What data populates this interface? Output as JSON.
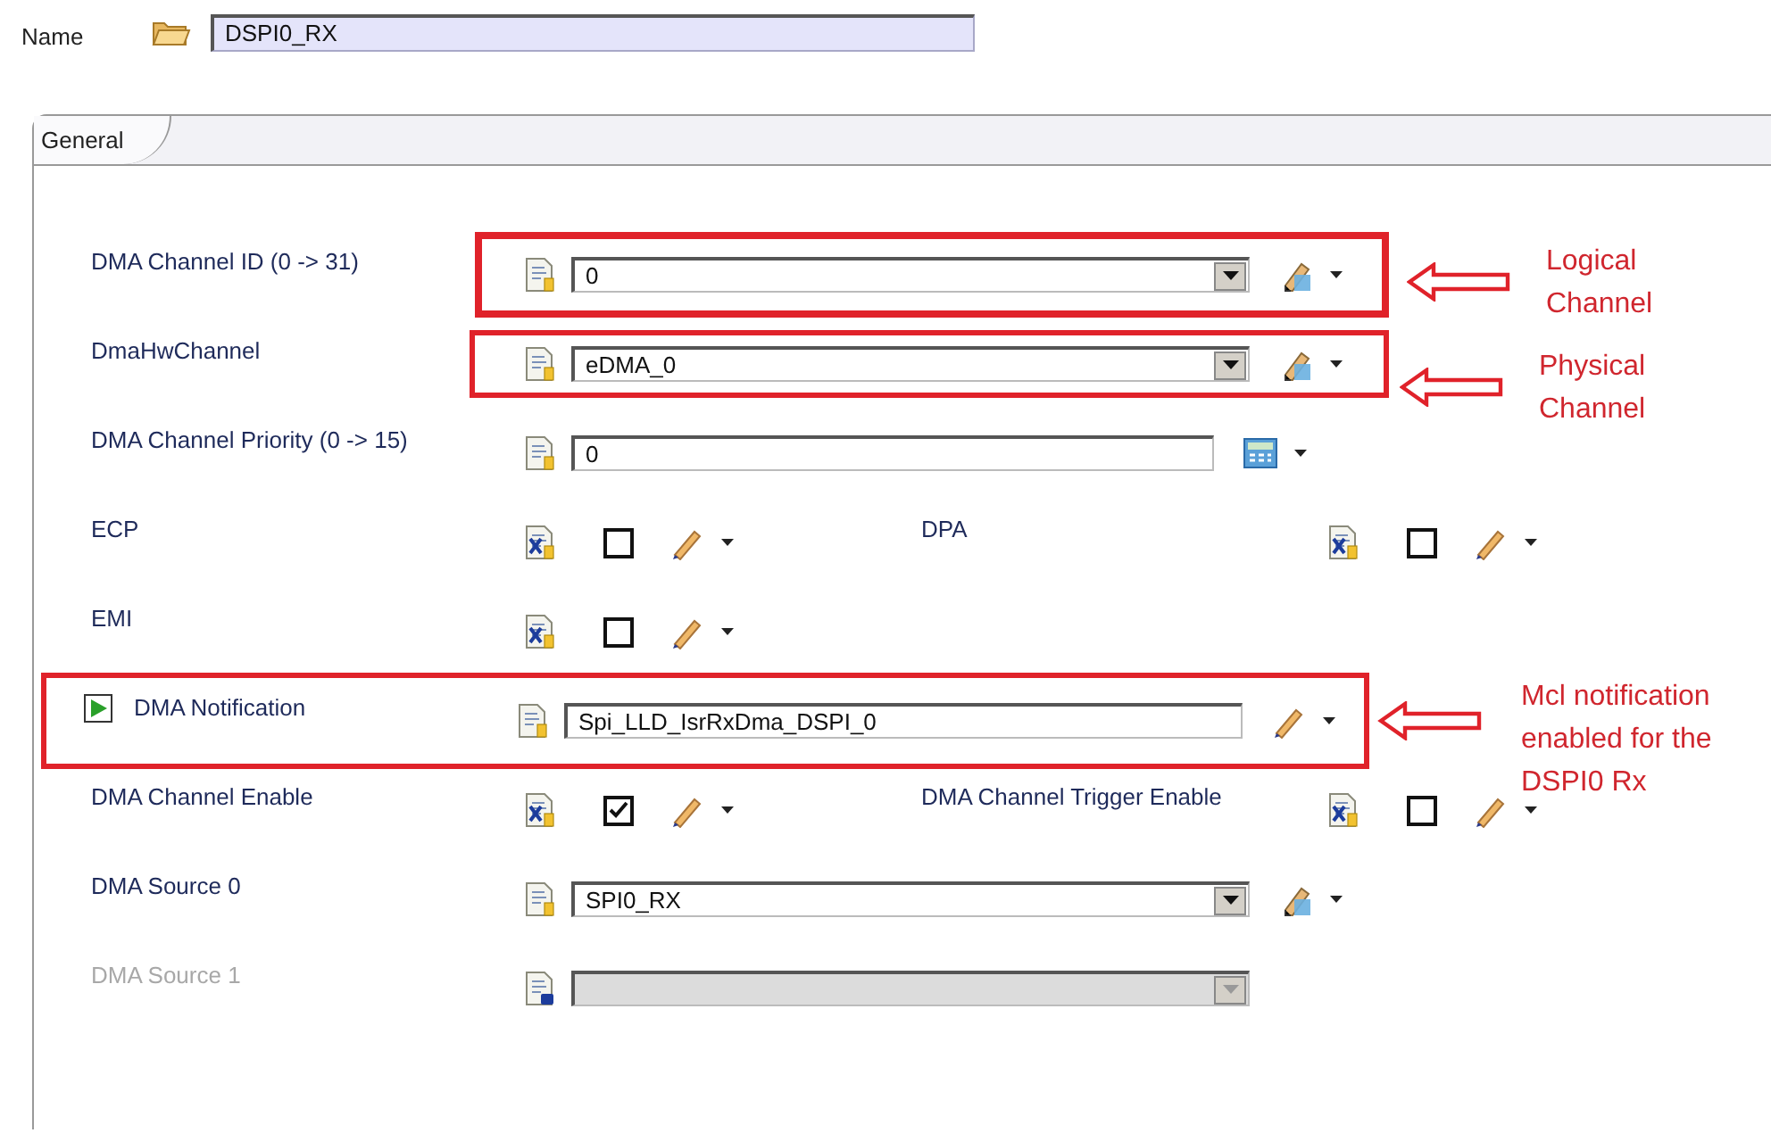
{
  "name_field": {
    "label": "Name",
    "value": "DSPI0_RX"
  },
  "tabs": [
    {
      "label": "General",
      "selected": true
    }
  ],
  "rows": [
    {
      "kind": "combo",
      "label": "DMA Channel ID (0 -> 31)",
      "value": "0",
      "disabled": false,
      "highlight": true,
      "callout": [
        "Logical",
        "Channel"
      ]
    },
    {
      "kind": "combo",
      "label": "DmaHwChannel",
      "value": "eDMA_0",
      "disabled": false,
      "highlight": true,
      "callout": [
        "Physical",
        "Channel"
      ]
    },
    {
      "kind": "number",
      "label": "DMA Channel Priority (0 -> 15)",
      "value": "0",
      "disabled": false
    },
    {
      "kind": "checkbox",
      "items": [
        {
          "label": "ECP",
          "checked": false
        },
        {
          "label": "DPA",
          "checked": false
        }
      ]
    },
    {
      "kind": "checkbox",
      "items": [
        {
          "label": "EMI",
          "checked": false
        }
      ]
    },
    {
      "kind": "function",
      "label": "DMA Notification",
      "value": "Spi_LLD_IsrRxDma_DSPI_0",
      "disabled": false,
      "highlight": true,
      "callout": [
        "Mcl notification",
        "enabled for the",
        "DSPI0 Rx"
      ]
    },
    {
      "kind": "checkbox",
      "items": [
        {
          "label": "DMA Channel Enable",
          "checked": true
        },
        {
          "label": "DMA Channel Trigger Enable",
          "checked": false
        }
      ]
    },
    {
      "kind": "combo",
      "label": "DMA Source 0",
      "value": "SPI0_RX",
      "disabled": false
    },
    {
      "kind": "combo",
      "label": "DMA Source 1",
      "disabled": true
    }
  ]
}
